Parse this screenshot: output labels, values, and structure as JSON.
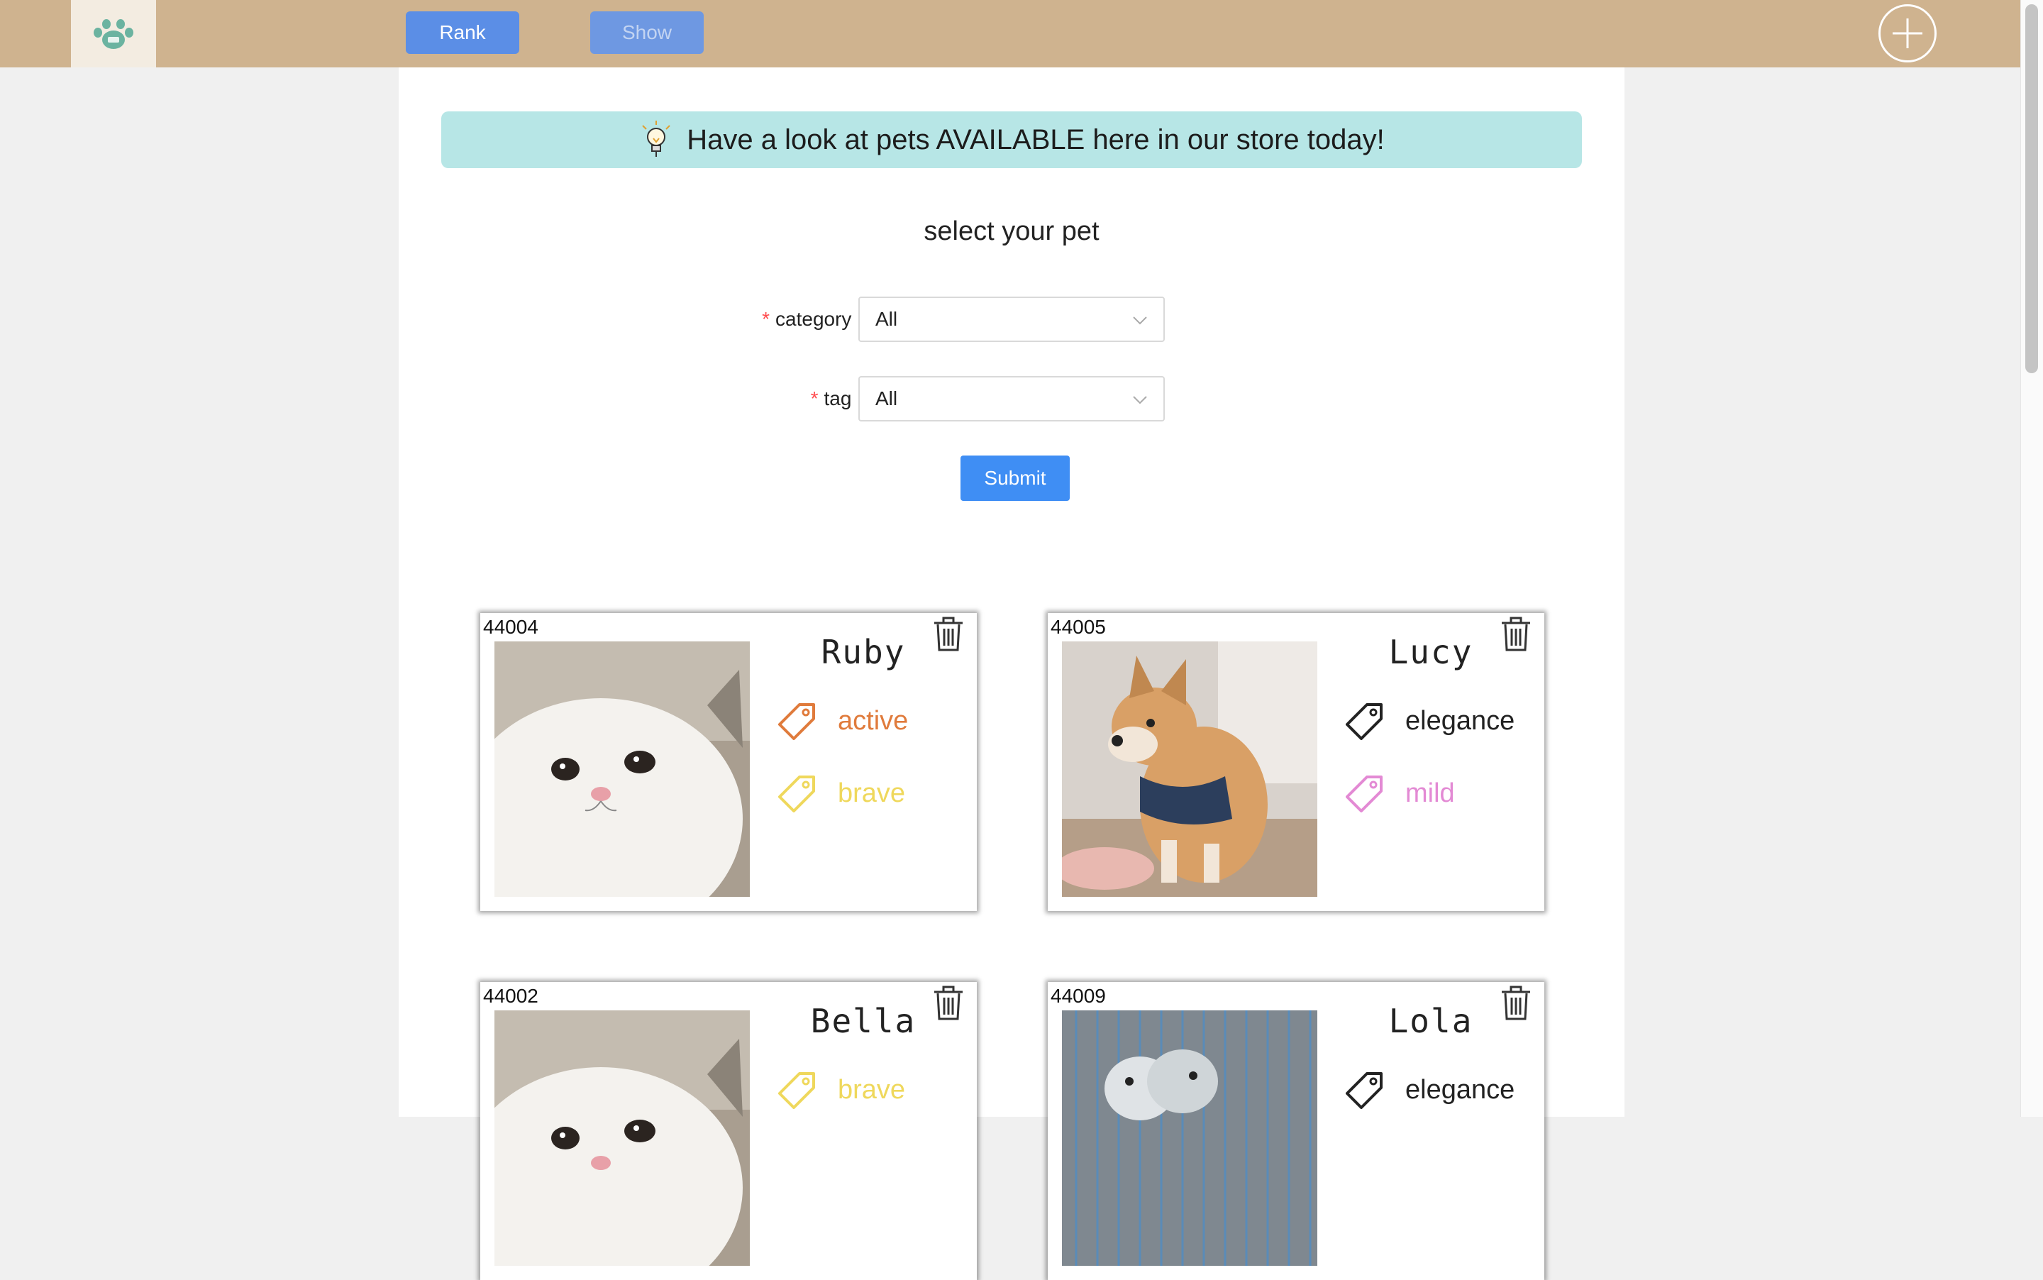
{
  "topbar": {
    "rank_label": "Rank",
    "show_label": "Show"
  },
  "banner": {
    "text": "Have a look at pets AVAILABLE here in our store today!"
  },
  "form": {
    "title": "select your pet",
    "category_label": "category",
    "category_value": "All",
    "tag_label": "tag",
    "tag_value": "All",
    "submit_label": "Submit"
  },
  "colors": {
    "topbar": "#cfb38f",
    "banner": "#b7e6e6",
    "primary": "#3f8ef4",
    "tag_active": "#e07b3c",
    "tag_brave": "#efd85c",
    "tag_elegance": "#222222",
    "tag_mild": "#e38ad4"
  },
  "pets": [
    {
      "id": "44004",
      "name": "Ruby",
      "photo": "white-cat",
      "tags": [
        {
          "label": "active",
          "color": "#e07b3c"
        },
        {
          "label": "brave",
          "color": "#efd85c"
        }
      ]
    },
    {
      "id": "44005",
      "name": "Lucy",
      "photo": "shiba-dog",
      "tags": [
        {
          "label": "elegance",
          "color": "#222222"
        },
        {
          "label": "mild",
          "color": "#e38ad4"
        }
      ]
    },
    {
      "id": "44002",
      "name": "Bella",
      "photo": "white-cat",
      "tags": [
        {
          "label": "brave",
          "color": "#efd85c"
        }
      ]
    },
    {
      "id": "44009",
      "name": "Lola",
      "photo": "parrots-in-cage",
      "tags": [
        {
          "label": "elegance",
          "color": "#222222"
        }
      ]
    }
  ],
  "icons": {
    "logo": "paw-icon",
    "add": "plus-circle-icon",
    "banner": "lightbulb-icon",
    "delete": "trash-icon",
    "tag": "tag-icon",
    "dropdown": "chevron-down-icon"
  }
}
